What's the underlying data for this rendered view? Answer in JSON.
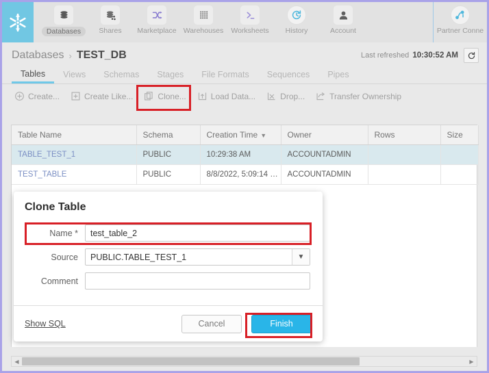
{
  "topnav": {
    "logo": "snowflake-logo",
    "items": [
      {
        "label": "Databases",
        "icon": "database-icon",
        "active": true
      },
      {
        "label": "Shares",
        "icon": "shares-icon",
        "active": false
      },
      {
        "label": "Marketplace",
        "icon": "shuffle-icon",
        "active": false
      },
      {
        "label": "Warehouses",
        "icon": "warehouse-grid-icon",
        "active": false
      },
      {
        "label": "Worksheets",
        "icon": "terminal-prompt-icon",
        "active": false
      },
      {
        "label": "History",
        "icon": "history-clock-icon",
        "active": false
      },
      {
        "label": "Account",
        "icon": "user-avatar-icon",
        "active": false
      }
    ],
    "partner": {
      "label": "Partner Conne",
      "icon": "partner-connect-icon"
    }
  },
  "breadcrumb": {
    "root": "Databases",
    "separator": "›",
    "current": "TEST_DB"
  },
  "refresh": {
    "label": "Last refreshed",
    "time": "10:30:52 AM",
    "icon": "refresh-icon"
  },
  "tabs": [
    {
      "label": "Tables",
      "active": true
    },
    {
      "label": "Views",
      "active": false
    },
    {
      "label": "Schemas",
      "active": false
    },
    {
      "label": "Stages",
      "active": false
    },
    {
      "label": "File Formats",
      "active": false
    },
    {
      "label": "Sequences",
      "active": false
    },
    {
      "label": "Pipes",
      "active": false
    }
  ],
  "toolbar": [
    {
      "label": "Create...",
      "icon": "plus-circle-icon"
    },
    {
      "label": "Create Like...",
      "icon": "copy-plus-icon"
    },
    {
      "label": "Clone...",
      "icon": "clone-icon",
      "highlighted": true
    },
    {
      "label": "Load Data...",
      "icon": "upload-icon"
    },
    {
      "label": "Drop...",
      "icon": "drop-x-icon"
    },
    {
      "label": "Transfer Ownership",
      "icon": "transfer-icon"
    }
  ],
  "table": {
    "columns": [
      {
        "label": "Table Name",
        "sorted": false
      },
      {
        "label": "Schema",
        "sorted": false
      },
      {
        "label": "Creation Time",
        "sorted": true,
        "caret": "▼"
      },
      {
        "label": "Owner",
        "sorted": false
      },
      {
        "label": "Rows",
        "sorted": false
      },
      {
        "label": "Size",
        "sorted": false
      }
    ],
    "rows": [
      {
        "selected": true,
        "cells": [
          "TABLE_TEST_1",
          "PUBLIC",
          "10:29:38 AM",
          "ACCOUNTADMIN",
          "",
          ""
        ]
      },
      {
        "selected": false,
        "cells": [
          "TEST_TABLE",
          "PUBLIC",
          "8/8/2022, 5:09:14 P...",
          "ACCOUNTADMIN",
          "",
          ""
        ]
      }
    ]
  },
  "dialog": {
    "title": "Clone Table",
    "fields": {
      "name": {
        "label": "Name *",
        "value": "test_table_2",
        "placeholder": "",
        "highlighted": true
      },
      "source": {
        "label": "Source",
        "value": "PUBLIC.TABLE_TEST_1",
        "arrow_icon": "chevron-down-icon"
      },
      "comment": {
        "label": "Comment",
        "value": "",
        "placeholder": ""
      }
    },
    "show_sql": "Show SQL",
    "cancel": "Cancel",
    "finish": "Finish"
  },
  "scrollbar": {
    "left_arrow": "◀",
    "right_arrow": "▶"
  },
  "colors": {
    "brand_blue": "#29b5e8",
    "logo_bg": "#71c7e3",
    "highlight_red": "#d81f26",
    "page_border": "#a9a2e8",
    "row_selected": "#d9e9ee",
    "tab_underline": "#6fc8e8"
  }
}
